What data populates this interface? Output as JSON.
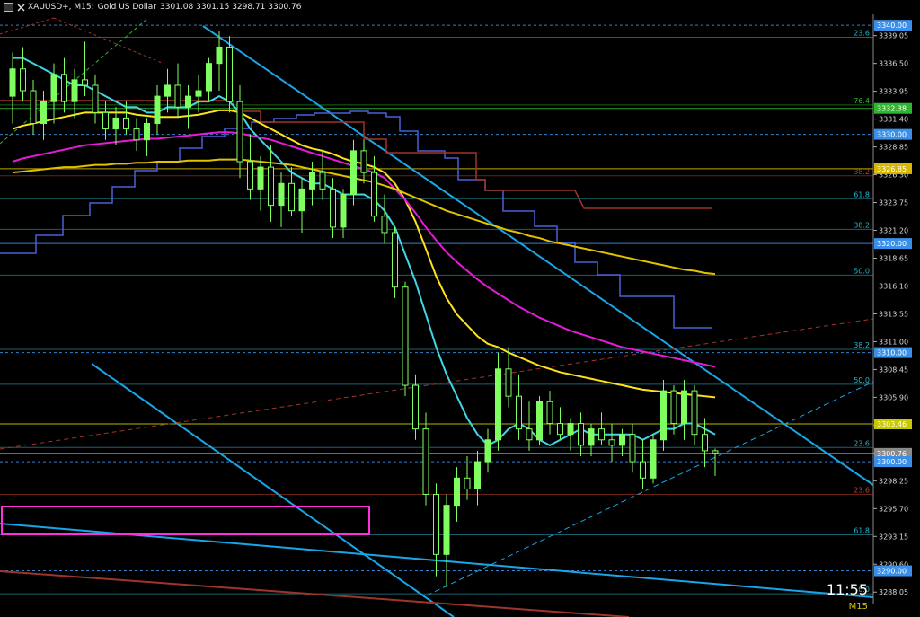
{
  "header": {
    "symbol": "XAUUSD+, M15:",
    "description": "Gold US Dollar",
    "ohlc": "3301.08 3301.15 3298.71 3300.76"
  },
  "clock": "11:55",
  "timeframe": "M15",
  "colors": {
    "background": "#000000",
    "bull": "#7fff5f",
    "cyan_ma": "#3fd6e6",
    "yellow_ma": "#ffe21a",
    "magenta_ma": "#e51bd7",
    "slow_ma": "#e0c200",
    "blue_step": "#4a60d8",
    "red_step": "#a0342a",
    "trendline": "#19a6e8",
    "fib": "#2ab3c8",
    "zone": "#ff2fe0"
  },
  "chart_data": {
    "type": "candlestick",
    "symbol": "XAUUSD+",
    "timeframe": "M15",
    "ylim": [
      3287.0,
      3341.0
    ],
    "y_ticks": [
      3339.05,
      3336.5,
      3333.95,
      3331.4,
      3328.85,
      3326.3,
      3323.75,
      3321.2,
      3318.65,
      3316.1,
      3313.55,
      3311.0,
      3308.45,
      3305.9,
      3303.35,
      3300.8,
      3298.25,
      3295.7,
      3293.15,
      3290.6,
      3288.05
    ],
    "price_tags": [
      {
        "value": 3340.0,
        "color": "#3a90e8"
      },
      {
        "value": 3332.38,
        "color": "#2fb52f"
      },
      {
        "value": 3330.0,
        "color": "#3a90e8"
      },
      {
        "value": 3326.85,
        "color": "#d8b800"
      },
      {
        "value": 3320.0,
        "color": "#3a90e8"
      },
      {
        "value": 3310.0,
        "color": "#3a90e8"
      },
      {
        "value": 3303.46,
        "color": "#c8c800"
      },
      {
        "value": 3300.76,
        "color": "#8a8a8a"
      },
      {
        "value": 3300.0,
        "color": "#3a90e8"
      },
      {
        "value": 3290.0,
        "color": "#3a90e8"
      }
    ],
    "fib_labels": [
      {
        "label": "23.6",
        "value": 3338.9,
        "color": "#2ab3c8"
      },
      {
        "label": "76.4",
        "value": 3332.7,
        "color": "#2fb52f"
      },
      {
        "label": "38.2",
        "value": 3326.2,
        "color": "#c0402a"
      },
      {
        "label": "61.8",
        "value": 3324.1,
        "color": "#2ab3c8"
      },
      {
        "label": "38.2",
        "value": 3321.3,
        "color": "#2ab3c8"
      },
      {
        "label": "50.0",
        "value": 3317.1,
        "color": "#2ab3c8"
      },
      {
        "label": "38.2",
        "value": 3310.3,
        "color": "#2ab3c8"
      },
      {
        "label": "50.0",
        "value": 3307.1,
        "color": "#2ab3c8"
      },
      {
        "label": "23.6",
        "value": 3301.3,
        "color": "#2ab3c8"
      },
      {
        "label": "23.6",
        "value": 3297.0,
        "color": "#c0402a"
      },
      {
        "label": "61.8",
        "value": 3293.3,
        "color": "#2ab3c8"
      },
      {
        "label": "0.0",
        "value": 3287.9,
        "color": "#2ab3c8"
      }
    ],
    "candles": [
      {
        "o": 3333.5,
        "h": 3337.5,
        "l": 3331.0,
        "c": 3336.0
      },
      {
        "o": 3336.0,
        "h": 3338.0,
        "l": 3333.0,
        "c": 3334.0
      },
      {
        "o": 3334.0,
        "h": 3335.0,
        "l": 3330.0,
        "c": 3331.0
      },
      {
        "o": 3331.0,
        "h": 3334.0,
        "l": 3329.5,
        "c": 3333.0
      },
      {
        "o": 3333.0,
        "h": 3336.5,
        "l": 3331.0,
        "c": 3335.5
      },
      {
        "o": 3335.5,
        "h": 3337.0,
        "l": 3332.0,
        "c": 3333.0
      },
      {
        "o": 3333.0,
        "h": 3336.0,
        "l": 3331.5,
        "c": 3335.0
      },
      {
        "o": 3335.0,
        "h": 3338.5,
        "l": 3333.5,
        "c": 3334.5
      },
      {
        "o": 3334.5,
        "h": 3335.5,
        "l": 3331.0,
        "c": 3332.0
      },
      {
        "o": 3332.0,
        "h": 3333.0,
        "l": 3329.5,
        "c": 3330.5
      },
      {
        "o": 3330.5,
        "h": 3332.5,
        "l": 3329.0,
        "c": 3331.5
      },
      {
        "o": 3331.5,
        "h": 3333.0,
        "l": 3330.0,
        "c": 3330.5
      },
      {
        "o": 3330.5,
        "h": 3331.5,
        "l": 3328.5,
        "c": 3329.5
      },
      {
        "o": 3329.5,
        "h": 3331.5,
        "l": 3328.0,
        "c": 3331.0
      },
      {
        "o": 3331.0,
        "h": 3334.5,
        "l": 3330.0,
        "c": 3333.5
      },
      {
        "o": 3333.5,
        "h": 3336.0,
        "l": 3332.0,
        "c": 3334.5
      },
      {
        "o": 3334.5,
        "h": 3336.5,
        "l": 3331.5,
        "c": 3332.5
      },
      {
        "o": 3332.5,
        "h": 3334.5,
        "l": 3330.5,
        "c": 3333.5
      },
      {
        "o": 3333.5,
        "h": 3335.5,
        "l": 3332.0,
        "c": 3334.0
      },
      {
        "o": 3334.0,
        "h": 3337.0,
        "l": 3333.0,
        "c": 3336.5
      },
      {
        "o": 3336.5,
        "h": 3339.5,
        "l": 3334.0,
        "c": 3338.0
      },
      {
        "o": 3338.0,
        "h": 3339.0,
        "l": 3332.0,
        "c": 3333.0
      },
      {
        "o": 3333.0,
        "h": 3334.5,
        "l": 3326.0,
        "c": 3327.5
      },
      {
        "o": 3327.5,
        "h": 3330.0,
        "l": 3324.0,
        "c": 3325.0
      },
      {
        "o": 3325.0,
        "h": 3328.0,
        "l": 3323.0,
        "c": 3327.0
      },
      {
        "o": 3327.0,
        "h": 3329.0,
        "l": 3322.0,
        "c": 3323.5
      },
      {
        "o": 3323.5,
        "h": 3326.5,
        "l": 3321.5,
        "c": 3325.5
      },
      {
        "o": 3325.5,
        "h": 3327.0,
        "l": 3322.5,
        "c": 3323.0
      },
      {
        "o": 3323.0,
        "h": 3326.0,
        "l": 3321.0,
        "c": 3325.0
      },
      {
        "o": 3325.0,
        "h": 3327.5,
        "l": 3323.5,
        "c": 3326.5
      },
      {
        "o": 3326.5,
        "h": 3328.5,
        "l": 3324.0,
        "c": 3325.0
      },
      {
        "o": 3325.0,
        "h": 3326.0,
        "l": 3320.5,
        "c": 3321.5
      },
      {
        "o": 3321.5,
        "h": 3325.0,
        "l": 3320.5,
        "c": 3324.5
      },
      {
        "o": 3324.5,
        "h": 3329.5,
        "l": 3323.5,
        "c": 3328.5
      },
      {
        "o": 3328.5,
        "h": 3329.5,
        "l": 3325.5,
        "c": 3326.5
      },
      {
        "o": 3326.5,
        "h": 3328.0,
        "l": 3322.0,
        "c": 3322.5
      },
      {
        "o": 3322.5,
        "h": 3324.5,
        "l": 3320.0,
        "c": 3321.0
      },
      {
        "o": 3321.0,
        "h": 3321.5,
        "l": 3315.0,
        "c": 3316.0
      },
      {
        "o": 3316.0,
        "h": 3316.5,
        "l": 3306.0,
        "c": 3307.0
      },
      {
        "o": 3307.0,
        "h": 3308.0,
        "l": 3302.0,
        "c": 3303.0
      },
      {
        "o": 3303.0,
        "h": 3304.5,
        "l": 3296.0,
        "c": 3297.0
      },
      {
        "o": 3297.0,
        "h": 3298.0,
        "l": 3289.5,
        "c": 3291.5
      },
      {
        "o": 3291.5,
        "h": 3297.0,
        "l": 3288.5,
        "c": 3296.0
      },
      {
        "o": 3296.0,
        "h": 3299.5,
        "l": 3294.5,
        "c": 3298.5
      },
      {
        "o": 3298.5,
        "h": 3300.5,
        "l": 3296.5,
        "c": 3297.5
      },
      {
        "o": 3297.5,
        "h": 3301.0,
        "l": 3296.0,
        "c": 3300.0
      },
      {
        "o": 3300.0,
        "h": 3303.0,
        "l": 3299.0,
        "c": 3302.0
      },
      {
        "o": 3302.0,
        "h": 3310.0,
        "l": 3301.0,
        "c": 3308.5
      },
      {
        "o": 3308.5,
        "h": 3310.5,
        "l": 3305.0,
        "c": 3306.0
      },
      {
        "o": 3306.0,
        "h": 3308.0,
        "l": 3302.0,
        "c": 3303.0
      },
      {
        "o": 3303.0,
        "h": 3305.5,
        "l": 3301.0,
        "c": 3302.0
      },
      {
        "o": 3302.0,
        "h": 3306.0,
        "l": 3301.5,
        "c": 3305.5
      },
      {
        "o": 3305.5,
        "h": 3306.5,
        "l": 3302.5,
        "c": 3303.5
      },
      {
        "o": 3303.5,
        "h": 3305.0,
        "l": 3302.0,
        "c": 3302.5
      },
      {
        "o": 3302.5,
        "h": 3304.0,
        "l": 3301.0,
        "c": 3303.5
      },
      {
        "o": 3303.5,
        "h": 3304.5,
        "l": 3300.5,
        "c": 3301.5
      },
      {
        "o": 3301.5,
        "h": 3303.5,
        "l": 3300.5,
        "c": 3303.0
      },
      {
        "o": 3303.0,
        "h": 3304.5,
        "l": 3301.5,
        "c": 3302.0
      },
      {
        "o": 3302.0,
        "h": 3303.5,
        "l": 3300.0,
        "c": 3301.5
      },
      {
        "o": 3301.5,
        "h": 3303.0,
        "l": 3300.5,
        "c": 3302.5
      },
      {
        "o": 3302.5,
        "h": 3303.5,
        "l": 3299.0,
        "c": 3300.0
      },
      {
        "o": 3300.0,
        "h": 3302.0,
        "l": 3297.5,
        "c": 3298.5
      },
      {
        "o": 3298.5,
        "h": 3302.5,
        "l": 3298.0,
        "c": 3302.0
      },
      {
        "o": 3302.0,
        "h": 3307.5,
        "l": 3301.0,
        "c": 3306.5
      },
      {
        "o": 3306.5,
        "h": 3307.0,
        "l": 3302.5,
        "c": 3303.5
      },
      {
        "o": 3303.5,
        "h": 3307.5,
        "l": 3302.0,
        "c": 3306.5
      },
      {
        "o": 3306.5,
        "h": 3307.0,
        "l": 3301.5,
        "c": 3302.5
      },
      {
        "o": 3302.5,
        "h": 3304.0,
        "l": 3299.5,
        "c": 3301.0
      },
      {
        "o": 3301.0,
        "h": 3301.2,
        "l": 3298.7,
        "c": 3300.8
      }
    ],
    "series": [
      {
        "name": "",
        "color": "#3fd6e6",
        "values": [
          3337,
          3337,
          3336.5,
          3336,
          3335.5,
          3335,
          3334.5,
          3334.5,
          3334,
          3333.5,
          3333,
          3332.5,
          3332.5,
          3332,
          3332,
          3332.5,
          3332.5,
          3332.5,
          3333,
          3333,
          3333.5,
          3333,
          3332,
          3330.5,
          3329.5,
          3328.5,
          3327.5,
          3326.5,
          3326,
          3325.5,
          3325.5,
          3325,
          3324.5,
          3324.5,
          3324.5,
          3324,
          3323,
          3321.5,
          3319,
          3316.5,
          3313.5,
          3310.5,
          3308,
          3306,
          3304,
          3302.5,
          3301.5,
          3302,
          3303,
          3303.5,
          3303,
          3302,
          3301.5,
          3302,
          3302.5,
          3303,
          3302.5,
          3302.5,
          3302.5,
          3302.5,
          3302.5,
          3302,
          3302.5,
          3303,
          3303,
          3303.5,
          3303.5,
          3303,
          3302.5
        ]
      },
      {
        "name": "",
        "color": "#ffe21a",
        "values": [
          3330.5,
          3330.8,
          3331,
          3331.2,
          3331.4,
          3331.6,
          3331.8,
          3332,
          3332,
          3332,
          3332,
          3332,
          3331.8,
          3331.7,
          3331.6,
          3331.6,
          3331.6,
          3331.7,
          3331.8,
          3332,
          3332.2,
          3332.2,
          3332,
          3331.5,
          3331,
          3330.5,
          3330,
          3329.5,
          3329,
          3328.7,
          3328.5,
          3328.2,
          3327.8,
          3327.5,
          3327.3,
          3327,
          3326.5,
          3325.5,
          3324,
          3322,
          3319.5,
          3317,
          3315,
          3313.5,
          3312.5,
          3311.5,
          3310.8,
          3310.5,
          3310,
          3309.6,
          3309.2,
          3308.8,
          3308.5,
          3308.2,
          3308,
          3307.8,
          3307.6,
          3307.4,
          3307.2,
          3307,
          3306.8,
          3306.6,
          3306.5,
          3306.4,
          3306.3,
          3306.2,
          3306.1,
          3306,
          3305.9
        ]
      },
      {
        "name": "",
        "color": "#e51bd7",
        "values": [
          3327.5,
          3327.8,
          3328,
          3328.2,
          3328.4,
          3328.6,
          3328.8,
          3329,
          3329.1,
          3329.2,
          3329.3,
          3329.4,
          3329.5,
          3329.6,
          3329.6,
          3329.7,
          3329.8,
          3329.9,
          3330,
          3330.1,
          3330.2,
          3330.2,
          3330.1,
          3329.9,
          3329.7,
          3329.5,
          3329.2,
          3328.9,
          3328.6,
          3328.3,
          3328,
          3327.7,
          3327.4,
          3327.1,
          3326.8,
          3326.5,
          3326,
          3325,
          3324,
          3322.8,
          3321.5,
          3320.3,
          3319.2,
          3318.3,
          3317.5,
          3316.7,
          3316,
          3315.4,
          3314.8,
          3314.2,
          3313.7,
          3313.2,
          3312.8,
          3312.4,
          3312,
          3311.7,
          3311.4,
          3311.1,
          3310.8,
          3310.5,
          3310.3,
          3310.1,
          3309.9,
          3309.7,
          3309.5,
          3309.3,
          3309.1,
          3308.9,
          3308.7
        ]
      },
      {
        "name": "",
        "color": "#e0c200",
        "values": [
          3326.5,
          3326.6,
          3326.7,
          3326.8,
          3326.9,
          3327,
          3327,
          3327.1,
          3327.2,
          3327.2,
          3327.3,
          3327.3,
          3327.4,
          3327.4,
          3327.5,
          3327.5,
          3327.5,
          3327.6,
          3327.6,
          3327.6,
          3327.7,
          3327.7,
          3327.7,
          3327.6,
          3327.5,
          3327.4,
          3327.3,
          3327.2,
          3327,
          3326.8,
          3326.6,
          3326.4,
          3326.2,
          3326,
          3325.8,
          3325.6,
          3325.3,
          3325,
          3324.6,
          3324.2,
          3323.8,
          3323.4,
          3323,
          3322.7,
          3322.4,
          3322.1,
          3321.8,
          3321.5,
          3321.2,
          3321,
          3320.7,
          3320.5,
          3320.2,
          3320,
          3319.8,
          3319.6,
          3319.4,
          3319.2,
          3319,
          3318.8,
          3318.6,
          3318.4,
          3318.2,
          3318,
          3317.8,
          3317.6,
          3317.5,
          3317.3,
          3317.2
        ]
      }
    ]
  }
}
